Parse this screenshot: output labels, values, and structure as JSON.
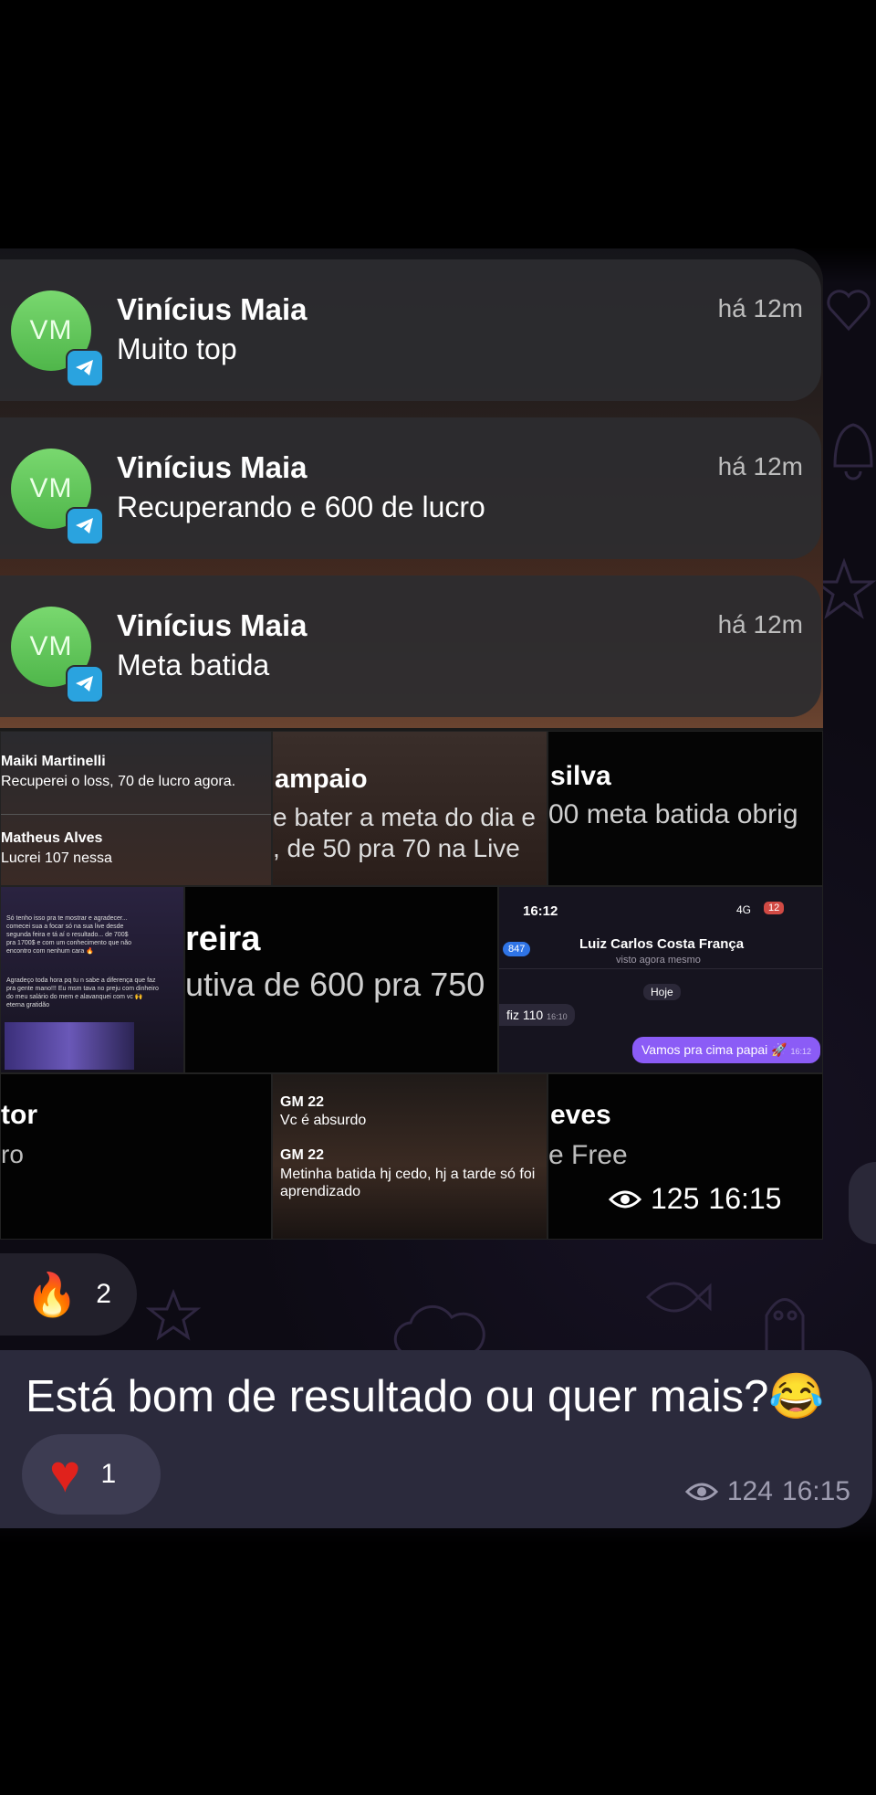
{
  "notifications": [
    {
      "initials": "VM",
      "name": "Vinícius Maia",
      "time": "há 12m",
      "text": "Muito top"
    },
    {
      "initials": "VM",
      "name": "Vinícius Maia",
      "time": "há 12m",
      "text": "Recuperando e 600 de lucro"
    },
    {
      "initials": "VM",
      "name": "Vinícius Maia",
      "time": "há 12m",
      "text": "Meta batida"
    }
  ],
  "tiles": {
    "t1": {
      "name1": "Maiki Martinelli",
      "msg1": "Recuperei o loss, 70 de lucro agora.",
      "name2": "Matheus Alves",
      "msg2": "Lucrei 107 nessa"
    },
    "t2": {
      "name": "ampaio",
      "line1": "e bater a meta do dia e",
      "line2": ", de 50 pra 70 na Live"
    },
    "t3": {
      "name": "silva",
      "line1": "00 meta batida obrig"
    },
    "t4": {
      "msg1": "Só tenho isso pra te mostrar e agradecer... comecei sua a focar só na sua live desde segunda feira e tá aí o resultado... de 700$ pra 1700$ e com um conhecimento que não encontro com nenhum cara 🔥",
      "msg2": "Agradeço toda hora pq tu n sabe a diferença que faz pra gente mano!!! Eu msm tava no preju com dinheiro do meu salário do mem e alavanquei com vc 🙌 eterna gratidão"
    },
    "t5": {
      "name": "reira",
      "line1": "utiva de 600 pra 750"
    },
    "t6": {
      "clock": "16:12",
      "network": "4G",
      "battery": "12",
      "badge": "847",
      "contact": "Luiz Carlos Costa França",
      "status": "visto agora mesmo",
      "day": "Hoje",
      "incoming": "fiz 110",
      "incoming_time": "16:10",
      "outgoing": "Vamos pra cima papai 🚀",
      "outgoing_time": "16:12"
    },
    "t7": {
      "name": "tor",
      "line1": "ro"
    },
    "t8": {
      "name1": "GM 22",
      "msg1": "Vc é absurdo",
      "name2": "GM 22",
      "msg2": "Metinha batida hj cedo, hj a tarde só foi aprendizado"
    },
    "t9": {
      "name": "eves",
      "line1": "e Free"
    }
  },
  "album_meta": {
    "views": "125",
    "time": "16:15"
  },
  "fire_reaction": {
    "emoji": "🔥",
    "count": "2"
  },
  "message": {
    "text": "Está bom de resultado ou quer mais?😂",
    "heart_emoji": "♥",
    "heart_count": "1",
    "views": "124",
    "time": "16:15"
  },
  "colors": {
    "accent_purple": "#8b5cf6",
    "telegram_blue": "#2aa3df",
    "avatar_green": "#5cc452"
  }
}
